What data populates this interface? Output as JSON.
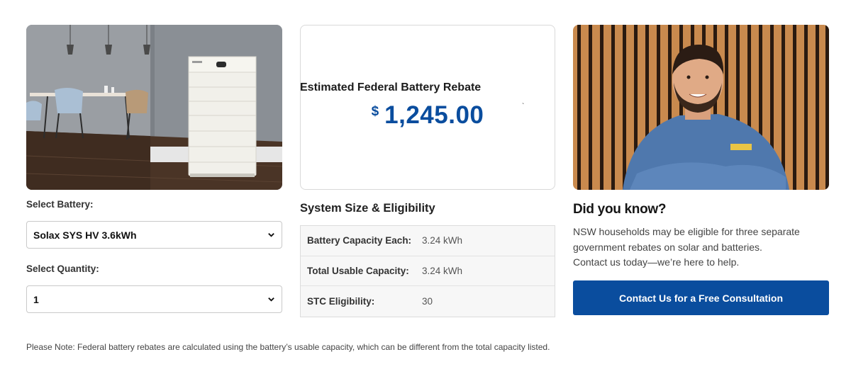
{
  "battery": {
    "label": "Select Battery:",
    "selected": "Solax SYS HV 3.6kWh"
  },
  "quantity": {
    "label": "Select Quantity:",
    "selected": "1"
  },
  "rebate": {
    "title": "Estimated Federal Battery Rebate",
    "currency": "$",
    "amount": "1,245.00",
    "tick": "`"
  },
  "eligibility": {
    "title": "System Size & Eligibility",
    "rows": [
      {
        "key": "Battery Capacity Each:",
        "value": "3.24 kWh"
      },
      {
        "key": "Total Usable Capacity:",
        "value": "3.24 kWh"
      },
      {
        "key": "STC Eligibility:",
        "value": "30"
      }
    ]
  },
  "info": {
    "title": "Did you know?",
    "text": "NSW households may be eligible for three separate government rebates on solar and batteries.",
    "cta_text": "Contact us today—we’re here to help.",
    "button_label": "Contact Us for a Free Consultation"
  },
  "note": "Please Note: Federal battery rebates are calculated using the battery’s usable capacity, which can be different from the total capacity listed.",
  "colors": {
    "brand_blue": "#0a4d9e",
    "text_dark": "#222222",
    "border": "#d9d9d9"
  }
}
